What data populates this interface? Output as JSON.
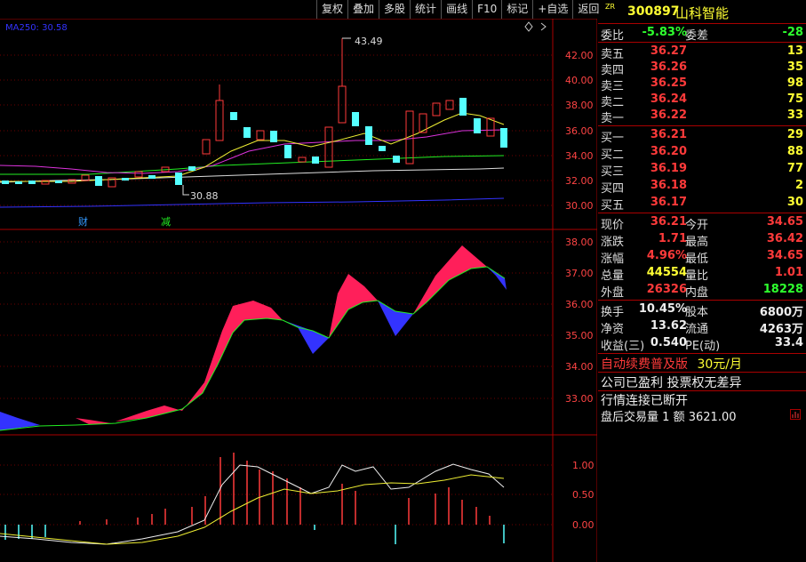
{
  "toolbar": [
    "复权",
    "叠加",
    "多股",
    "统计",
    "画线",
    "F10",
    "标记",
    "+自选",
    "返回"
  ],
  "ma_label": "MA250: 30.58",
  "price_axis": [
    "42.00",
    "40.00",
    "38.00",
    "36.00",
    "34.00",
    "32.00",
    "30.00"
  ],
  "high_mark": "43.49",
  "low_mark": "30.88",
  "event_tags": [
    "财",
    "减"
  ],
  "chip_axis": [
    "38.00",
    "37.00",
    "36.00",
    "35.00",
    "34.00",
    "33.00"
  ],
  "osc_axis": [
    "1.00",
    "0.50",
    "0.00"
  ],
  "stock": {
    "badge": "ZR",
    "code": "300897",
    "name": "山科智能"
  },
  "weibi": {
    "label": "委比",
    "value": "-5.83%",
    "label2": "委差",
    "value2": "-28"
  },
  "asks": [
    {
      "label": "卖五",
      "price": "36.27",
      "vol": "13"
    },
    {
      "label": "卖四",
      "price": "36.26",
      "vol": "35"
    },
    {
      "label": "卖三",
      "price": "36.25",
      "vol": "98"
    },
    {
      "label": "卖二",
      "price": "36.24",
      "vol": "75"
    },
    {
      "label": "卖一",
      "price": "36.22",
      "vol": "33"
    }
  ],
  "bids": [
    {
      "label": "买一",
      "price": "36.21",
      "vol": "29"
    },
    {
      "label": "买二",
      "price": "36.20",
      "vol": "88"
    },
    {
      "label": "买三",
      "price": "36.19",
      "vol": "77"
    },
    {
      "label": "买四",
      "price": "36.18",
      "vol": "2"
    },
    {
      "label": "买五",
      "price": "36.17",
      "vol": "30"
    }
  ],
  "quote": [
    {
      "l1": "现价",
      "v1": "36.21",
      "l2": "今开",
      "v2": "34.65"
    },
    {
      "l1": "涨跌",
      "v1": "1.71",
      "l2": "最高",
      "v2": "36.42"
    },
    {
      "l1": "涨幅",
      "v1": "4.96%",
      "l2": "最低",
      "v2": "34.65"
    },
    {
      "l1": "总量",
      "v1": "44554",
      "l2": "量比",
      "v2": "1.01"
    },
    {
      "l1": "外盘",
      "v1": "26326",
      "l2": "内盘",
      "v2": "18228"
    }
  ],
  "fin": [
    {
      "l1": "换手",
      "v1": "10.45%",
      "l2": "股本",
      "v2": "6800万"
    },
    {
      "l1": "净资",
      "v1": "13.62",
      "l2": "流通",
      "v2": "4263万"
    },
    {
      "l1": "收益(三)",
      "v1": "0.540",
      "l2": "PE(动)",
      "v2": "33.4"
    }
  ],
  "promo": {
    "text": "自动续费普及版",
    "price": "30元/月"
  },
  "notice": "公司已盈利 投票权无差异",
  "status": "行情连接已断开",
  "after_hours": {
    "text": "盘后交易量",
    "qty": "1",
    "amt_label": "额",
    "amt": "3621.00"
  },
  "colors": {
    "up": "#ff3a3a",
    "down": "#5ff",
    "frame": "#a00"
  }
}
